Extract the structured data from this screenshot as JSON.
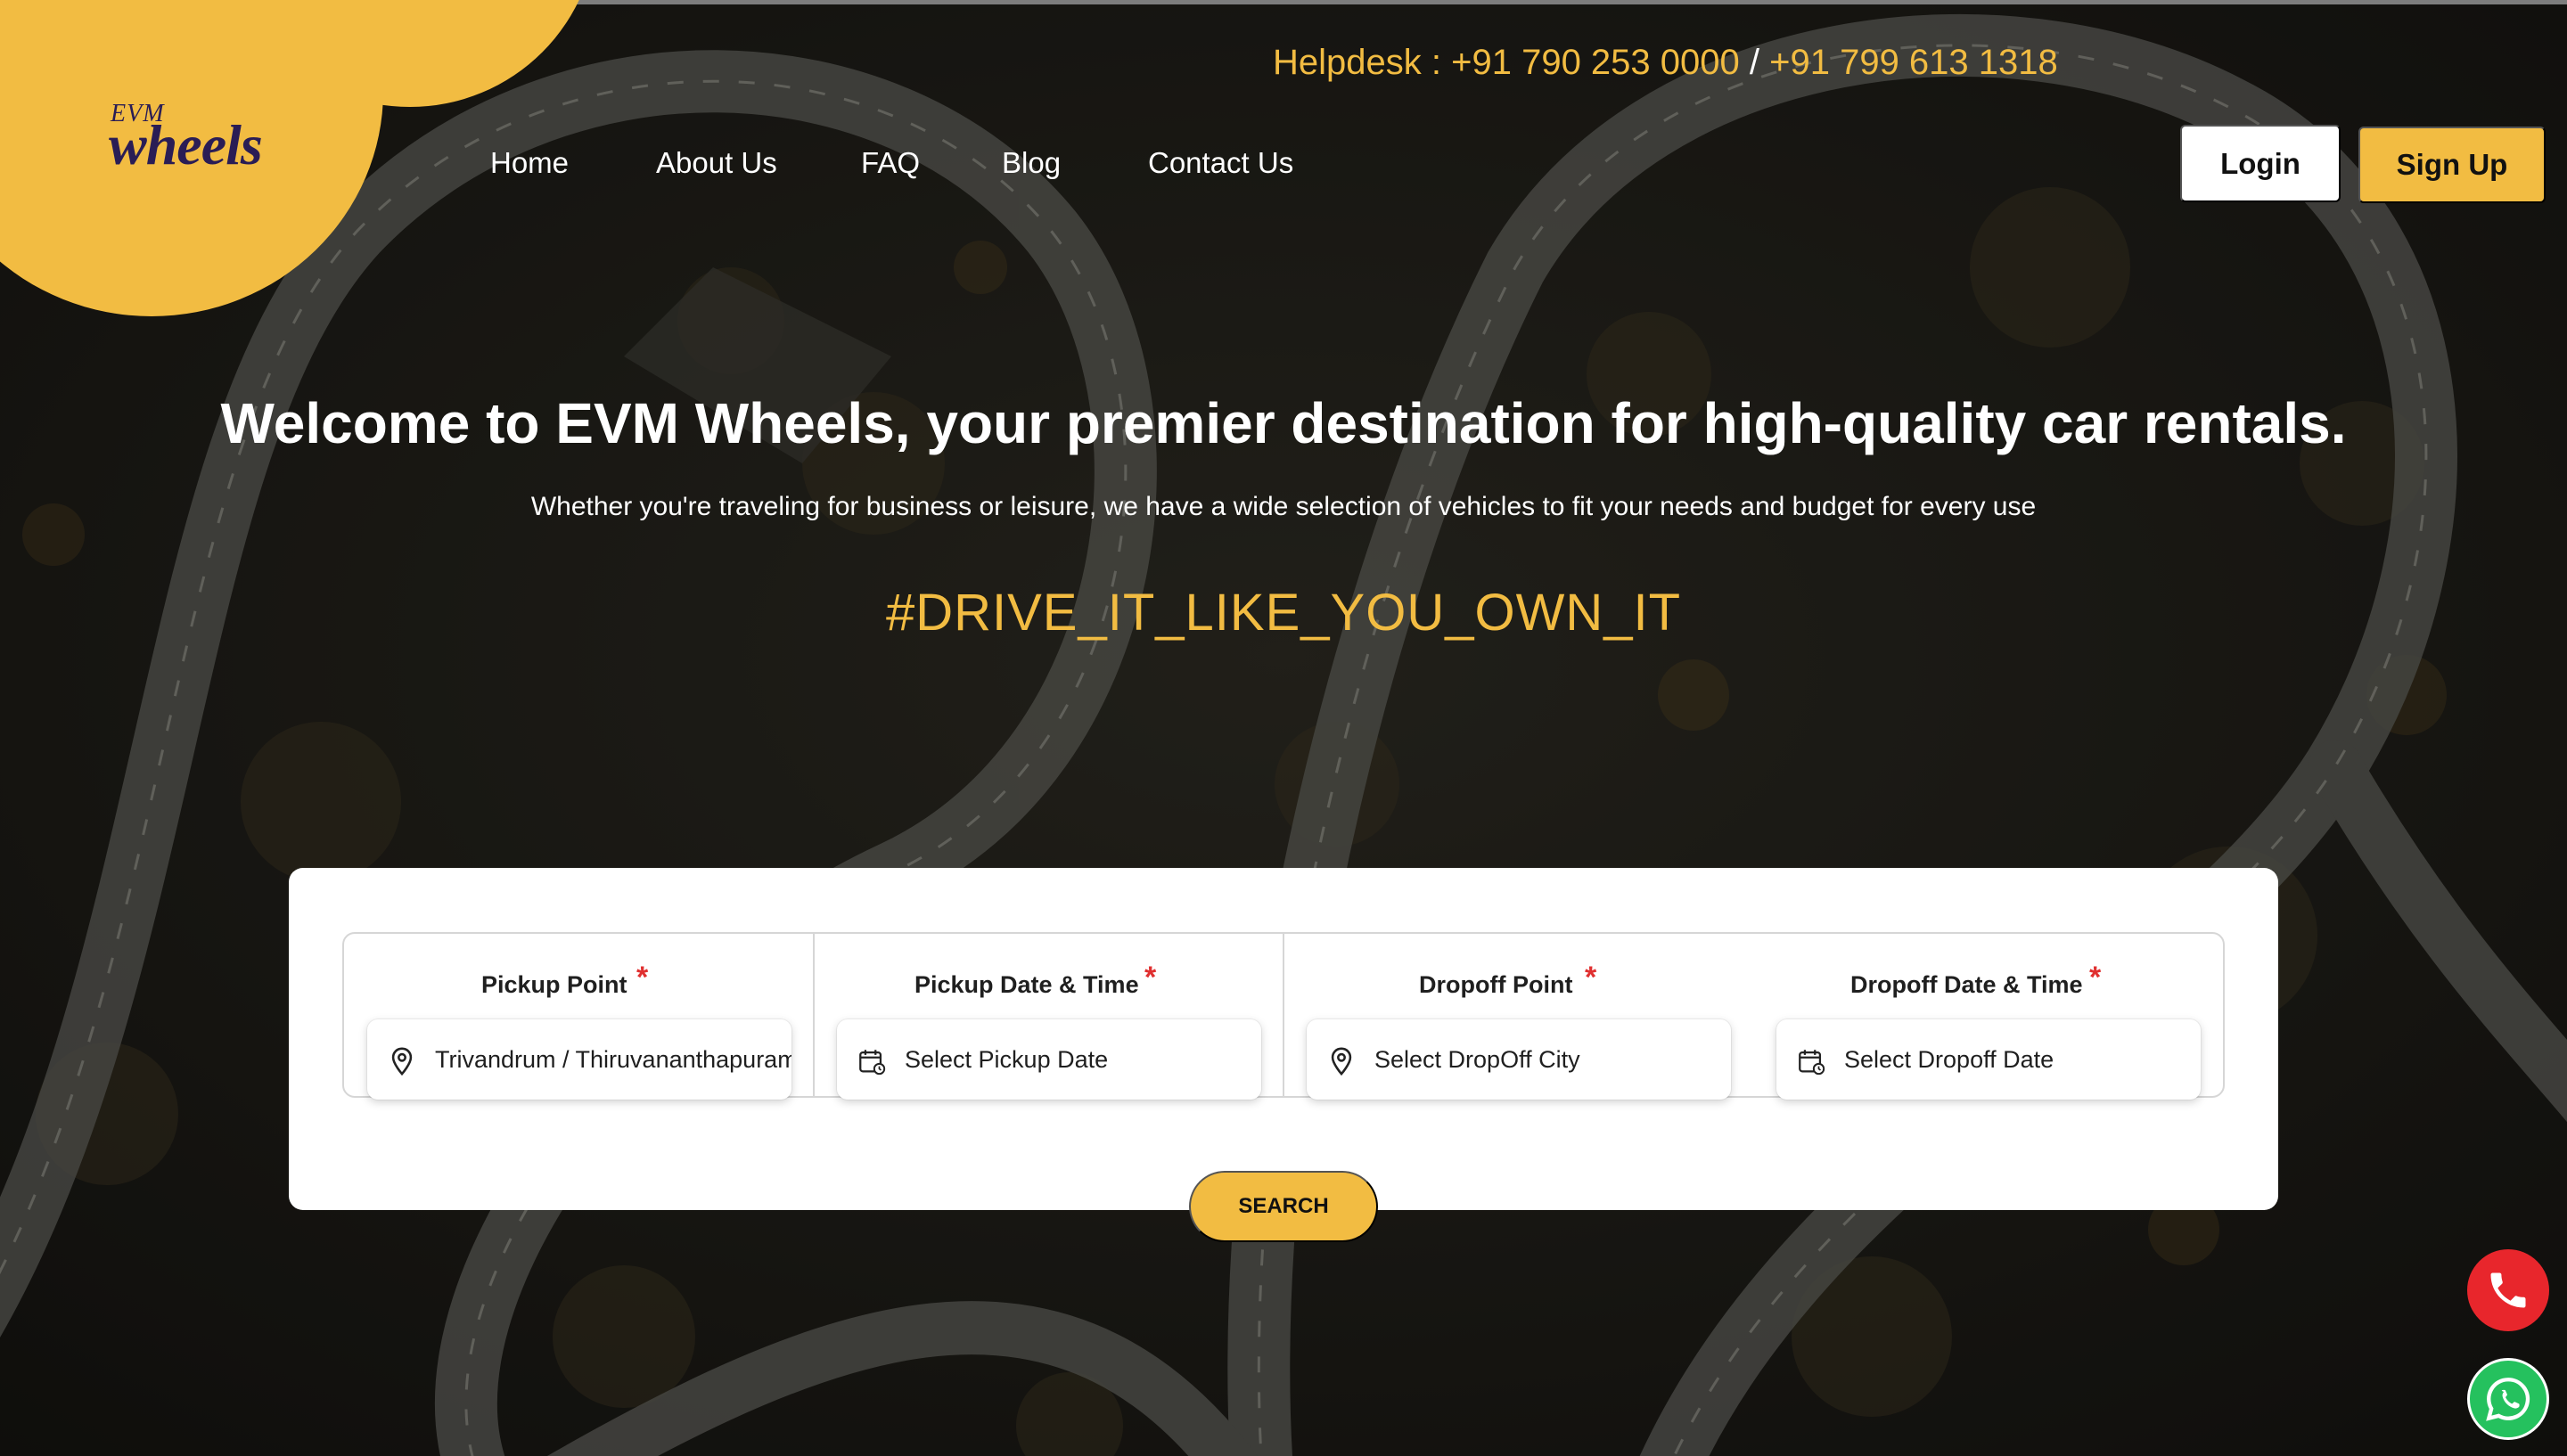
{
  "brand": {
    "logo_small": "EVM",
    "logo_big": "wheels",
    "accent_color": "#f2bc42"
  },
  "header": {
    "helpdesk_label": "Helpdesk : ",
    "phone_1": "+91 790 253 0000",
    "separator": " / ",
    "phone_2": "+91 799 613 1318",
    "nav": [
      "Home",
      "About Us",
      "FAQ",
      "Blog",
      "Contact Us"
    ],
    "login_label": "Login",
    "signup_label": "Sign Up"
  },
  "hero": {
    "title": "Welcome to EVM Wheels, your premier destination for high-quality car rentals.",
    "subtitle": "Whether you're traveling for business or leisure, we have a wide selection of vehicles to fit your needs and budget for every use",
    "tagline": "#DRIVE_IT_LIKE_YOU_OWN_IT"
  },
  "search": {
    "fields": [
      {
        "label": "Pickup Point",
        "required": "*",
        "value": "Trivandrum / Thiruvananthapuram",
        "icon": "location-pin-icon"
      },
      {
        "label": "Pickup Date & Time",
        "required": "*",
        "placeholder": "Select Pickup Date",
        "icon": "calendar-icon"
      },
      {
        "label": "Dropoff Point",
        "required": "*",
        "placeholder": "Select DropOff City",
        "icon": "location-pin-icon"
      },
      {
        "label": "Dropoff Date & Time",
        "required": "*",
        "placeholder": "Select Dropoff Date",
        "icon": "calendar-icon"
      }
    ],
    "button_label": "SEARCH"
  },
  "floating": {
    "phone_icon": "phone-icon",
    "whatsapp_icon": "whatsapp-icon"
  }
}
